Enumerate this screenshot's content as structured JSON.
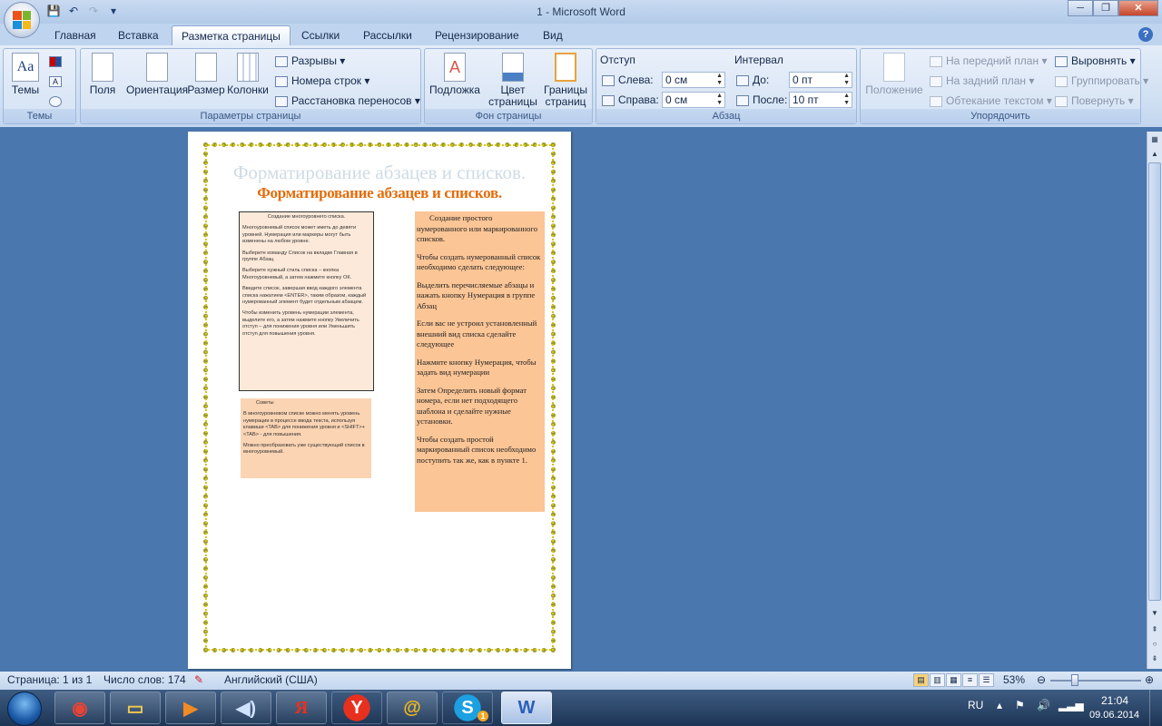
{
  "window": {
    "title": "1 - Microsoft Word"
  },
  "tabs": [
    "Главная",
    "Вставка",
    "Разметка страницы",
    "Ссылки",
    "Рассылки",
    "Рецензирование",
    "Вид"
  ],
  "ribbon": {
    "themes": {
      "label": "Темы",
      "button": "Темы"
    },
    "page_setup": {
      "label": "Параметры страницы",
      "fields": "Поля",
      "orientation": "Ориентация",
      "size": "Размер",
      "columns": "Колонки",
      "breaks": "Разрывы",
      "line_numbers": "Номера строк",
      "hyphenation": "Расстановка переносов"
    },
    "page_background": {
      "label": "Фон страницы",
      "watermark": "Подложка",
      "page_color_1": "Цвет",
      "page_color_2": "страницы",
      "borders_1": "Границы",
      "borders_2": "страниц"
    },
    "paragraph": {
      "label": "Абзац",
      "indent": "Отступ",
      "left": "Слева:",
      "left_value": "0 см",
      "right": "Справа:",
      "right_value": "0 см",
      "spacing": "Интервал",
      "before": "До:",
      "before_value": "0 пт",
      "after": "После:",
      "after_value": "10 пт"
    },
    "arrange": {
      "label": "Упорядочить",
      "position": "Положение",
      "bring_front": "На передний план",
      "send_back": "На задний план",
      "wrap": "Обтекание текстом",
      "align": "Выровнять",
      "group": "Группировать",
      "rotate": "Повернуть"
    }
  },
  "document": {
    "wordart_shadow": "Форматирование абзацев и списков.",
    "wordart": "Форматирование абзацев и списков.",
    "box1": [
      "Создание многоуровнего списка.",
      "Многоуровневый список может иметь до девяти уровней. Нумерация или маркеры могут быть изменены на любом уровне.",
      "Выберите команду Список на вкладке Главная в группе Абзац",
      "Выберите нужный стиль списка – кнопка Многоуровневый, а затем нажмите кнопку ОК.",
      "Введите список, завершая ввод каждого элемента списка нажатием <ENTER>, таким образом, каждый нумерованный элемент будет отдельным абзацем.",
      "Чтобы изменить уровень нумерации элемента, выделите его, а затем нажмите кнопку Увеличить отступ – для понижения уровня или Уменьшить отступ для повышения уровня."
    ],
    "box2": [
      "Советы",
      "В многоуровневом списке можно менять уровень нумерации в процессе ввода текста, используя клавиши <TAB> для понижения уровня и <SHIFT>+<TAB> - для повышения.",
      "Можно преобразовать уже существующий список в многоуровневый."
    ],
    "box3": [
      "Создание простого нумерованного или маркированного списков.",
      "Чтобы создать нумерованный список необходимо сделать следующее:",
      "Выделить перечисляемые абзацы и нажать кнопку Нумерация в группе Абзац",
      "Если вас не устроил установленный внешний вид списка сделайте следующее",
      "Нажмите кнопку Нумерация, чтобы задать вид нумерации",
      "Затем Определить новый формат номера, если нет подходящего шаблона и сделайте нужные установки.",
      "Чтобы создать простой маркированный список необходимо поступить так же, как в пункте 1."
    ]
  },
  "status": {
    "page": "Страница: 1 из 1",
    "words": "Число слов: 174",
    "language": "Английский (США)",
    "zoom": "53%"
  },
  "taskbar": {
    "lang": "RU",
    "time": "21:04",
    "date": "09.06.2014",
    "skype_badge": "1"
  }
}
